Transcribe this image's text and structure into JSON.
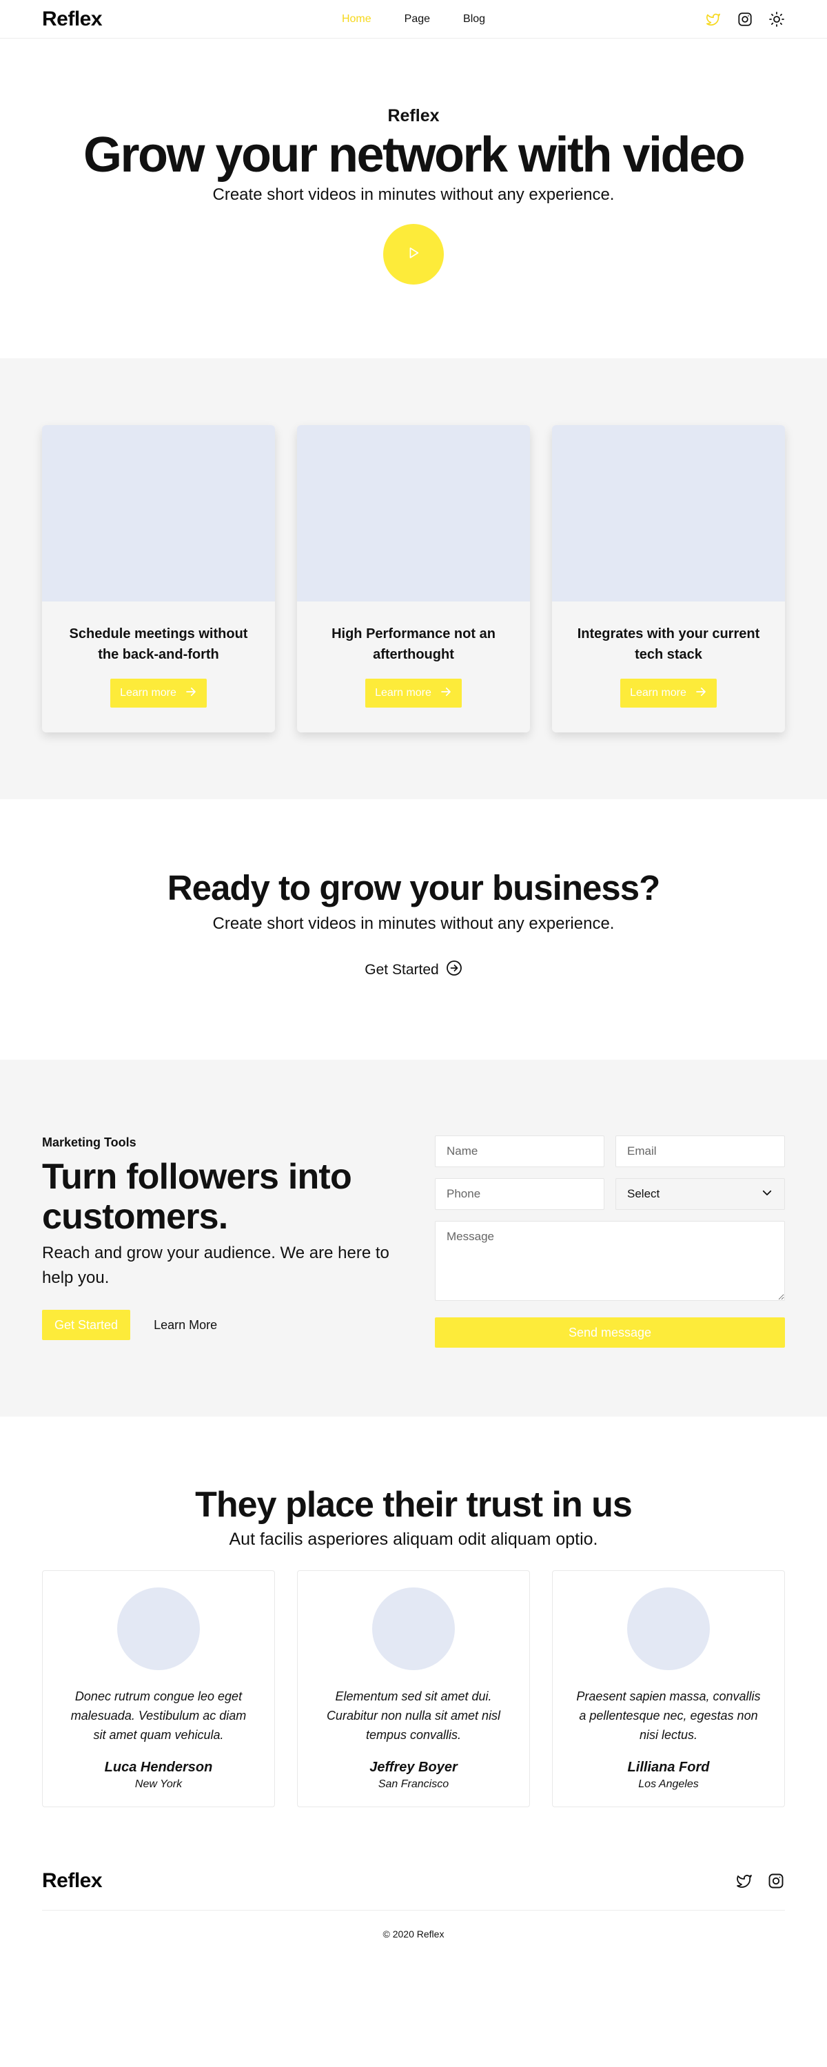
{
  "brand": "Reflex",
  "nav": [
    {
      "label": "Home",
      "active": true
    },
    {
      "label": "Page",
      "active": false
    },
    {
      "label": "Blog",
      "active": false
    }
  ],
  "header_icons": [
    "twitter-icon",
    "instagram-icon",
    "sun-icon"
  ],
  "colors": {
    "accent": "#fdeb3a",
    "active_nav": "#f6d81c",
    "section_bg": "#f5f5f5",
    "placeholder_image": "#e3e8f4"
  },
  "hero": {
    "eyebrow": "Reflex",
    "title": "Grow your network with video",
    "subtitle": "Create short videos in minutes without any experience."
  },
  "features": [
    {
      "title": "Schedule meetings without the back-and-forth",
      "button": "Learn more"
    },
    {
      "title": "High Performance not an afterthought",
      "button": "Learn more"
    },
    {
      "title": "Integrates with your current tech stack",
      "button": "Learn more"
    }
  ],
  "cta": {
    "title": "Ready to grow your business?",
    "subtitle": "Create short videos in minutes without any experience.",
    "button": "Get Started"
  },
  "marketing": {
    "eyebrow": "Marketing Tools",
    "title": "Turn followers into customers.",
    "text": "Reach and grow your audience. We are here to help you.",
    "primary_button": "Get Started",
    "secondary_button": "Learn More",
    "form": {
      "name_placeholder": "Name",
      "email_placeholder": "Email",
      "phone_placeholder": "Phone",
      "select_value": "Select",
      "message_placeholder": "Message",
      "submit": "Send message"
    }
  },
  "trust": {
    "title": "They place their trust in us",
    "subtitle": "Aut facilis asperiores aliquam odit aliquam optio.",
    "testimonials": [
      {
        "quote": "Donec rutrum congue leo eget malesuada. Vestibulum ac diam sit amet quam vehicula.",
        "name": "Luca Henderson",
        "city": "New York"
      },
      {
        "quote": "Elementum sed sit amet dui. Curabitur non nulla sit amet nisl tempus convallis.",
        "name": "Jeffrey Boyer",
        "city": "San Francisco"
      },
      {
        "quote": "Praesent sapien massa, convallis a pellentesque nec, egestas non nisi lectus.",
        "name": "Lilliana Ford",
        "city": "Los Angeles"
      }
    ]
  },
  "footer": {
    "brand": "Reflex",
    "icons": [
      "twitter-icon",
      "instagram-icon"
    ],
    "copyright": "© 2020 Reflex"
  }
}
